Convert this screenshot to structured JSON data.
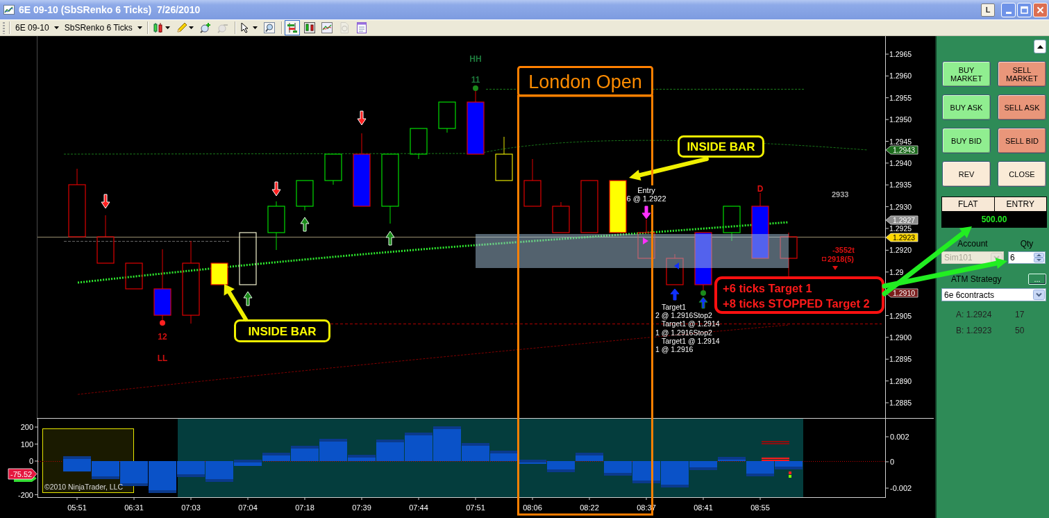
{
  "window": {
    "title": "6E 09-10 (SbSRenko 6 Ticks)  7/26/2010",
    "link_button": "L"
  },
  "toolbar": {
    "instrument": "6E 09-10",
    "bar_type": "SbSRenko 6 Ticks",
    "tools": [
      {
        "kind": "menu",
        "selected": false,
        "disabled": false
      },
      {
        "kind": "menu",
        "selected": false,
        "disabled": false
      },
      {
        "kind": "button",
        "selected": false,
        "disabled": false
      },
      {
        "kind": "button",
        "selected": false,
        "disabled": true
      },
      {
        "kind": "menu",
        "selected": false,
        "disabled": false
      },
      {
        "kind": "button",
        "selected": false,
        "disabled": false
      },
      {
        "kind": "button",
        "selected": true,
        "disabled": false
      },
      {
        "kind": "button",
        "selected": false,
        "disabled": false
      },
      {
        "kind": "button",
        "selected": false,
        "disabled": false
      },
      {
        "kind": "button",
        "selected": false,
        "disabled": true
      },
      {
        "kind": "button",
        "selected": false,
        "disabled": false
      }
    ]
  },
  "chart": {
    "price_axis": [
      "1.2965",
      "1.2960",
      "1.2955",
      "1.2950",
      "1.2945",
      "1.2940",
      "1.2935",
      "1.2930",
      "1.2925",
      "1.2920",
      "1.29",
      "1.2905",
      "1.2900",
      "1.2895",
      "1.2890",
      "1.2885"
    ],
    "price_tags": [
      {
        "text": "1.2943",
        "color": "#1c6b1c"
      },
      {
        "text": "1.2927",
        "color": "#8c8c8c"
      },
      {
        "text": "1.2923",
        "color": "#ffd700"
      },
      {
        "text": "1.2910",
        "color": "#7a1c1c"
      }
    ],
    "swing_labels": [
      {
        "text": "HH",
        "color": "#1e7a3c"
      },
      {
        "text": "11",
        "color": "#1e7a3c"
      },
      {
        "text": "12",
        "color": "#d01010"
      },
      {
        "text": "LL",
        "color": "#d01010"
      },
      {
        "text": "D",
        "color": "#e01010"
      }
    ],
    "session_label": "London Open",
    "callouts": [
      "INSIDE BAR",
      "INSIDE BAR"
    ],
    "result_note": [
      "+6 ticks Target 1",
      "+8 ticks STOPPED Target 2"
    ],
    "entry_note": [
      "Entry",
      "6 @ 1.2922"
    ],
    "order_notes": [
      "Target1",
      "2 @ 1.2916Stop2",
      "Target1 @ 1.2914",
      "1 @ 1.2916Stop2",
      "Target1 @ 1.2914",
      "1 @ 1.2916"
    ],
    "bar_counter": "2933",
    "position_stats": [
      "-3552t",
      "2918(5)"
    ]
  },
  "indicator": {
    "left_axis": [
      "200",
      "100",
      "0",
      "-200"
    ],
    "right_axis": [
      "0.002",
      "0",
      "-0.002"
    ],
    "value_tag": "-75.52",
    "copyright": "©2010 NinjaTrader, LLC"
  },
  "time_axis": [
    "05:51",
    "06:31",
    "07:03",
    "07:04",
    "07:18",
    "07:39",
    "07:44",
    "07:51",
    "08:06",
    "08:22",
    "08:37",
    "08:41",
    "08:55"
  ],
  "order_panel": {
    "buttons": [
      {
        "label": "BUY MARKET",
        "kind": "buy"
      },
      {
        "label": "SELL MARKET",
        "kind": "sell"
      },
      {
        "label": "BUY ASK",
        "kind": "buy"
      },
      {
        "label": "SELL ASK",
        "kind": "sell"
      },
      {
        "label": "BUY BID",
        "kind": "buy"
      },
      {
        "label": "SELL BID",
        "kind": "sell"
      },
      {
        "label": "REV",
        "kind": "action"
      },
      {
        "label": "CLOSE",
        "kind": "action"
      }
    ],
    "position": {
      "columns": [
        "FLAT",
        "ENTRY"
      ],
      "value": "500.00"
    },
    "account": {
      "label": "Account",
      "value": "Sim101",
      "disabled": true
    },
    "quantity": {
      "label": "Qty",
      "value": "6"
    },
    "atm_strategy": {
      "label": "ATM Strategy",
      "button": "...",
      "value": "6e 6contracts"
    },
    "quotes": [
      {
        "label": "A: 1.2924",
        "size": "17"
      },
      {
        "label": "B: 1.2923",
        "size": "50"
      }
    ]
  }
}
